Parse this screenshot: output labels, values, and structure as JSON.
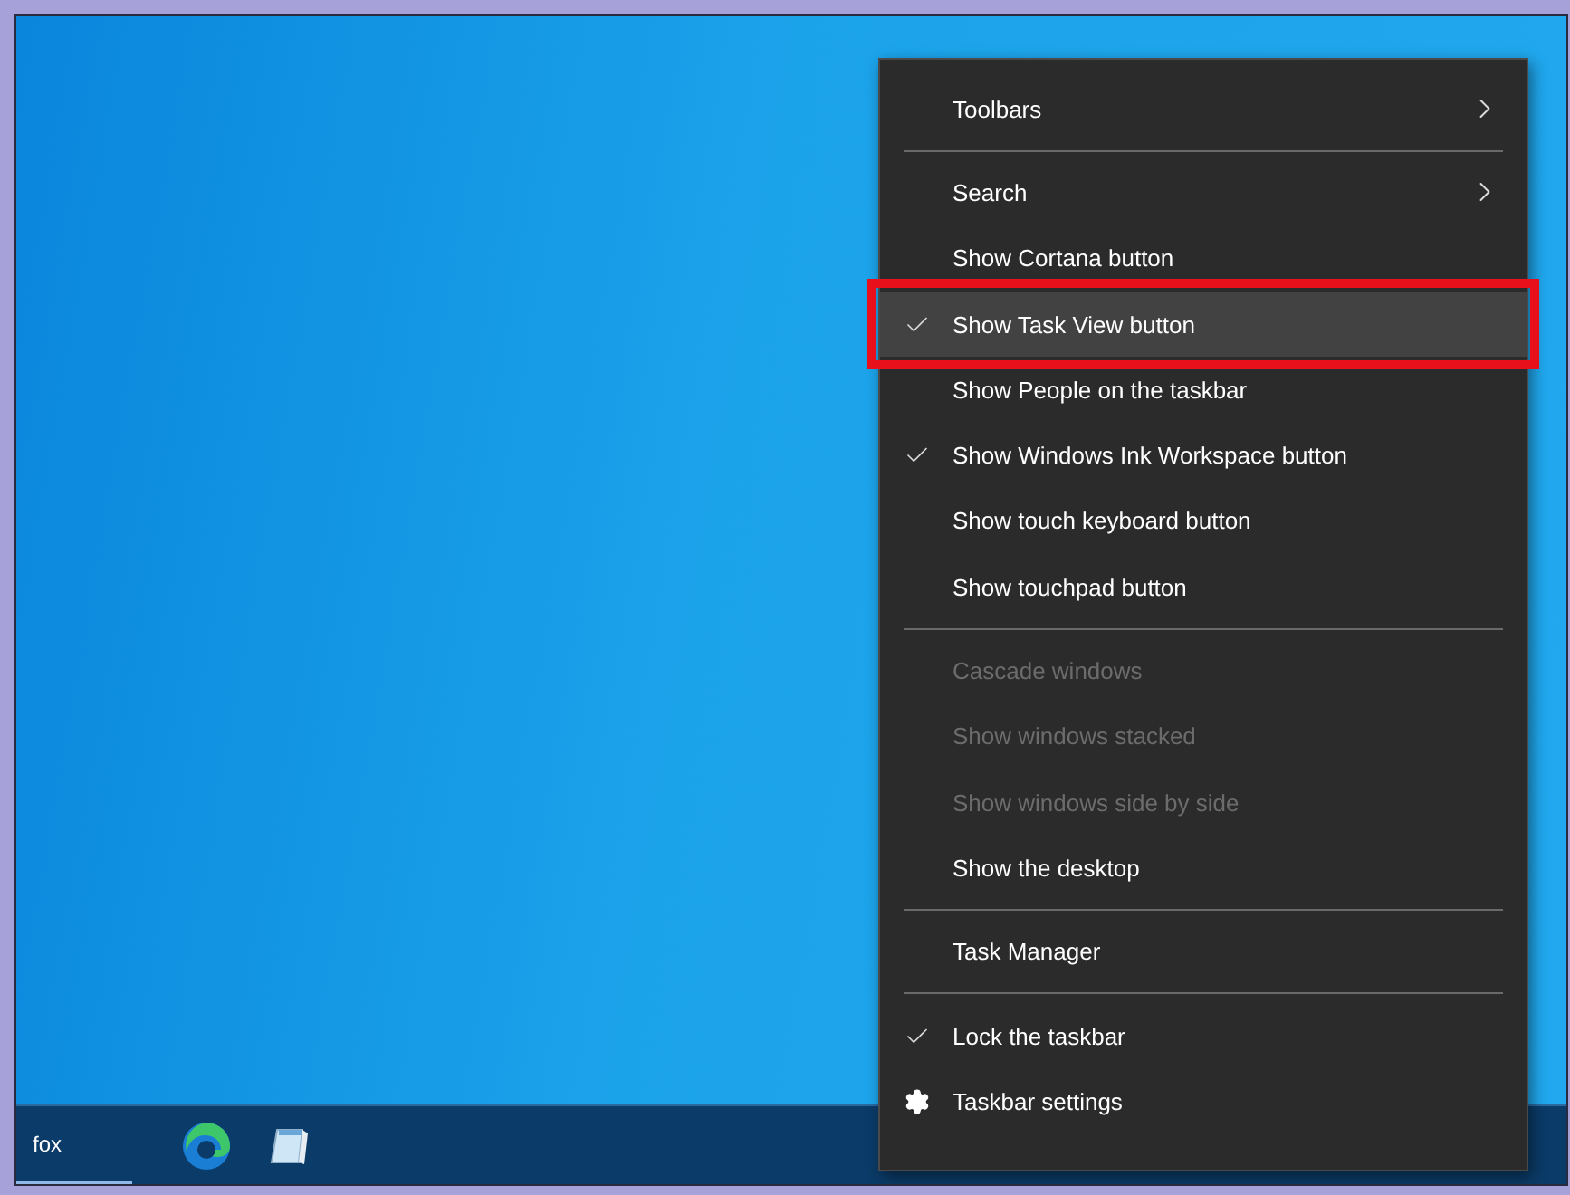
{
  "context_menu": {
    "items": [
      {
        "kind": "item",
        "label": "Toolbars",
        "checked": false,
        "disabled": false,
        "submenu": true,
        "highlighted": false
      },
      {
        "kind": "separator"
      },
      {
        "kind": "item",
        "label": "Search",
        "checked": false,
        "disabled": false,
        "submenu": true,
        "highlighted": false
      },
      {
        "kind": "item",
        "label": "Show Cortana button",
        "checked": false,
        "disabled": false,
        "submenu": false,
        "highlighted": false
      },
      {
        "kind": "item",
        "label": "Show Task View button",
        "checked": true,
        "disabled": false,
        "submenu": false,
        "highlighted": true
      },
      {
        "kind": "item",
        "label": "Show People on the taskbar",
        "checked": false,
        "disabled": false,
        "submenu": false,
        "highlighted": false
      },
      {
        "kind": "item",
        "label": "Show Windows Ink Workspace button",
        "checked": true,
        "disabled": false,
        "submenu": false,
        "highlighted": false
      },
      {
        "kind": "item",
        "label": "Show touch keyboard button",
        "checked": false,
        "disabled": false,
        "submenu": false,
        "highlighted": false
      },
      {
        "kind": "item",
        "label": "Show touchpad button",
        "checked": false,
        "disabled": false,
        "submenu": false,
        "highlighted": false
      },
      {
        "kind": "separator"
      },
      {
        "kind": "item",
        "label": "Cascade windows",
        "checked": false,
        "disabled": true,
        "submenu": false,
        "highlighted": false
      },
      {
        "kind": "item",
        "label": "Show windows stacked",
        "checked": false,
        "disabled": true,
        "submenu": false,
        "highlighted": false
      },
      {
        "kind": "item",
        "label": "Show windows side by side",
        "checked": false,
        "disabled": true,
        "submenu": false,
        "highlighted": false
      },
      {
        "kind": "item",
        "label": "Show the desktop",
        "checked": false,
        "disabled": false,
        "submenu": false,
        "highlighted": false
      },
      {
        "kind": "separator"
      },
      {
        "kind": "item",
        "label": "Task Manager",
        "checked": false,
        "disabled": false,
        "submenu": false,
        "highlighted": false
      },
      {
        "kind": "separator"
      },
      {
        "kind": "item",
        "label": "Lock the taskbar",
        "checked": true,
        "disabled": false,
        "submenu": false,
        "highlighted": false
      },
      {
        "kind": "settings",
        "label": "Taskbar settings",
        "disabled": false,
        "submenu": false,
        "highlighted": false
      }
    ]
  },
  "taskbar": {
    "items": [
      {
        "kind": "app",
        "label": "fox",
        "selected": true
      },
      {
        "kind": "browser"
      },
      {
        "kind": "notepad"
      }
    ]
  }
}
